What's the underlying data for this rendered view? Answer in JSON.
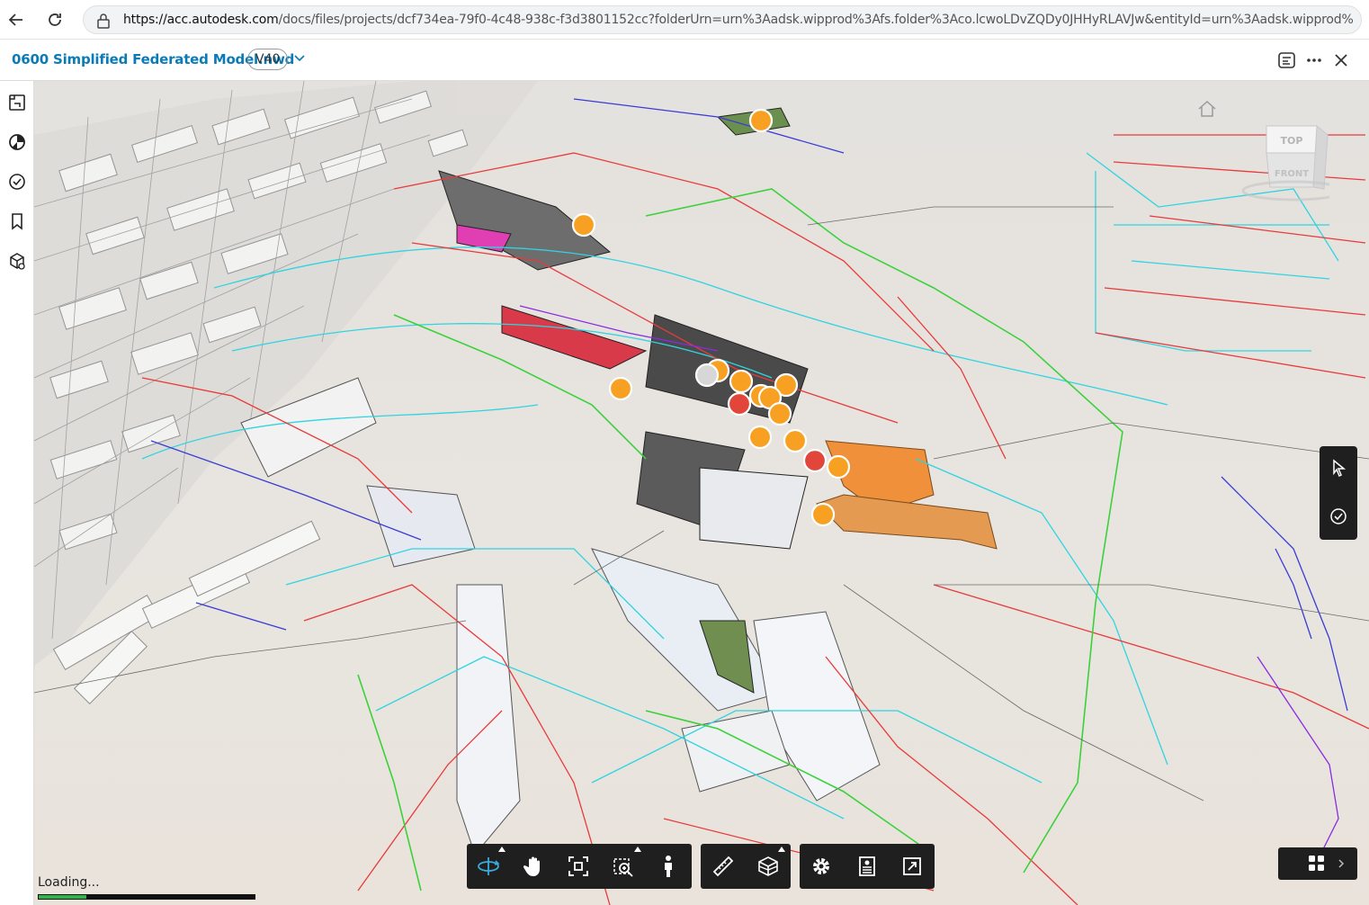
{
  "browser": {
    "url_host": "https://acc.autodesk.com",
    "url_rest": "/docs/files/projects/dcf734ea-79f0-4c48-938c-f3d3801152cc?folderUrn=urn%3Aadsk.wipprod%3Afs.folder%3Aco.lcwoLDvZQDy0JHHyRLAVJw&entityId=urn%3Aadsk.wipprod%3Adm.lineage%3..."
  },
  "header": {
    "file_name": "0600 Simplified Federated Model.nwd",
    "version": "V40"
  },
  "viewcube": {
    "top_label": "TOP",
    "front_label": "FRONT"
  },
  "loading": {
    "label": "Loading...",
    "progress": 0.22
  },
  "colors": {
    "accent": "#0b7bb8",
    "toolbar_bg": "#1f1f1f",
    "toolbar_active": "#38abdf",
    "issue_orange": "#f7a021",
    "issue_red": "#e2463a",
    "issue_gray": "#d7d7d7",
    "progress_green": "#2fb44a"
  },
  "left_toolbar": [
    "sheets-views-icon",
    "model-browser-icon",
    "issues-icon",
    "bookmarks-icon",
    "objects-icon"
  ],
  "bottom_toolbar": {
    "navigation": [
      "orbit-icon",
      "pan-icon",
      "fit-to-view-icon",
      "zoom-window-icon",
      "first-person-icon"
    ],
    "analysis": [
      "measure-icon",
      "section-analysis-icon"
    ],
    "settings": [
      "settings-icon",
      "properties-icon",
      "fullscreen-icon"
    ]
  }
}
